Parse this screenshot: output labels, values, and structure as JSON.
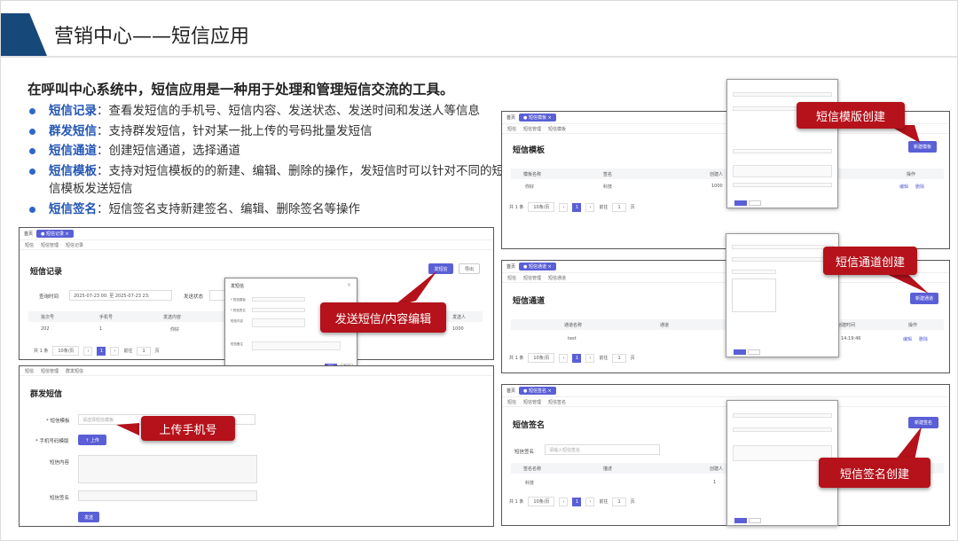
{
  "slide": {
    "title": "营销中心——短信应用",
    "intro": "在呼叫中心系统中，短信应用是一种用于处理和管理短信交流的工具。",
    "bullets": [
      {
        "key": "短信记录",
        "text": "：查看发短信的手机号、短信内容、发送状态、发送时间和发送人等信息"
      },
      {
        "key": "群发短信",
        "text": "：支持群发短信，针对某一批上传的号码批量发短信"
      },
      {
        "key": "短信通道",
        "text": "：创建短信通道，选择通道"
      },
      {
        "key": "短信模板",
        "text": "：支持对短信模板的的新建、编辑、删除的操作，发短信时可以针对不同的短信模板发送短信"
      },
      {
        "key": "短信签名",
        "text": "：短信签名支持新建签名、编辑、删除签名等操作"
      }
    ]
  },
  "callouts": {
    "template": "短信模版创建",
    "send": "发送短信/内容编辑",
    "upload": "上传手机号",
    "channel": "短信通道创建",
    "signature": "短信签名创建"
  },
  "records": {
    "tab_home": "首页",
    "tab_active": "● 短信记录 ×",
    "crumbs": [
      "短信",
      "短信管理",
      "短信记录"
    ],
    "title": "短信记录",
    "send_btn": "发短信",
    "export_btn": "导出",
    "query_label": "查询时间",
    "query_value": "2025-07-23 00: 至 2025-07-23 23:",
    "status_label": "发送状态",
    "headers": [
      "批次号",
      "手机号",
      "发送内容",
      "发送人"
    ],
    "row": [
      "202",
      "1",
      "你好",
      "1000"
    ],
    "pager": {
      "total": "共 1 条",
      "size": "10条/页",
      "page": "1",
      "goto": "前往",
      "goto_val": "1",
      "unit": "页"
    },
    "dialog": {
      "title": "发短信",
      "fields": [
        "* 短信模板",
        "* 短信签名",
        "短信内容",
        "短信备注"
      ],
      "ok": "确定",
      "cancel": "取消"
    }
  },
  "mass": {
    "crumbs": [
      "短信",
      "短信管理",
      "群发短信"
    ],
    "title": "群发短信",
    "template_label": "* 短信模板",
    "template_placeholder": "请选择短信模板",
    "phone_label": "* 手机号码模版",
    "upload_btn": "↑ 上传",
    "content_label": "短信内容",
    "sign_label": "短信签名",
    "send_btn": "发送"
  },
  "template": {
    "tab_home": "首页",
    "tab_active": "● 短信模板 ×",
    "crumbs": [
      "短信",
      "短信管理",
      "短信模板"
    ],
    "title": "短信模板",
    "new_btn": "新建模板",
    "headers": [
      "模板名称",
      "签名",
      "创建人",
      "操作"
    ],
    "row": [
      "你好",
      "科技",
      "1000",
      "编辑",
      "删除"
    ],
    "pager": {
      "total": "共 1 条",
      "size": "10条/页",
      "page": "1",
      "goto": "前往",
      "goto_val": "1",
      "unit": "页"
    }
  },
  "channel": {
    "tab_home": "首页",
    "tab_active": "● 短信通道 ×",
    "crumbs": [
      "短信",
      "短信管理",
      "短信通道"
    ],
    "title": "短信通道",
    "new_btn": "新建通道",
    "headers": [
      "通道名称",
      "通道",
      "创建时间",
      "操作"
    ],
    "row": [
      "test",
      "",
      "14:19:46",
      "编辑",
      "删除"
    ],
    "pager": {
      "total": "共 1 条",
      "size": "10条/页",
      "page": "1",
      "goto": "前往",
      "goto_val": "1",
      "unit": "页"
    }
  },
  "signature": {
    "tab_home": "首页",
    "tab_active": "● 短信签名 ×",
    "crumbs": [
      "短信",
      "短信管理",
      "短信签名"
    ],
    "title": "短信签名",
    "new_btn": "新建签名",
    "search_label": "短信签名",
    "search_placeholder": "请输入短信签名",
    "headers": [
      "签名名称",
      "描述",
      "创建人"
    ],
    "row": [
      "科技",
      "",
      "1"
    ],
    "pager": {
      "total": "共 1 条",
      "size": "10条/页",
      "page": "1",
      "goto": "前往",
      "goto_val": "1",
      "unit": "页"
    }
  },
  "colors": {
    "accent": "#17487a",
    "primary": "#5a5fd6",
    "callout": "#b5121b",
    "bullet_key": "#2356b5"
  }
}
